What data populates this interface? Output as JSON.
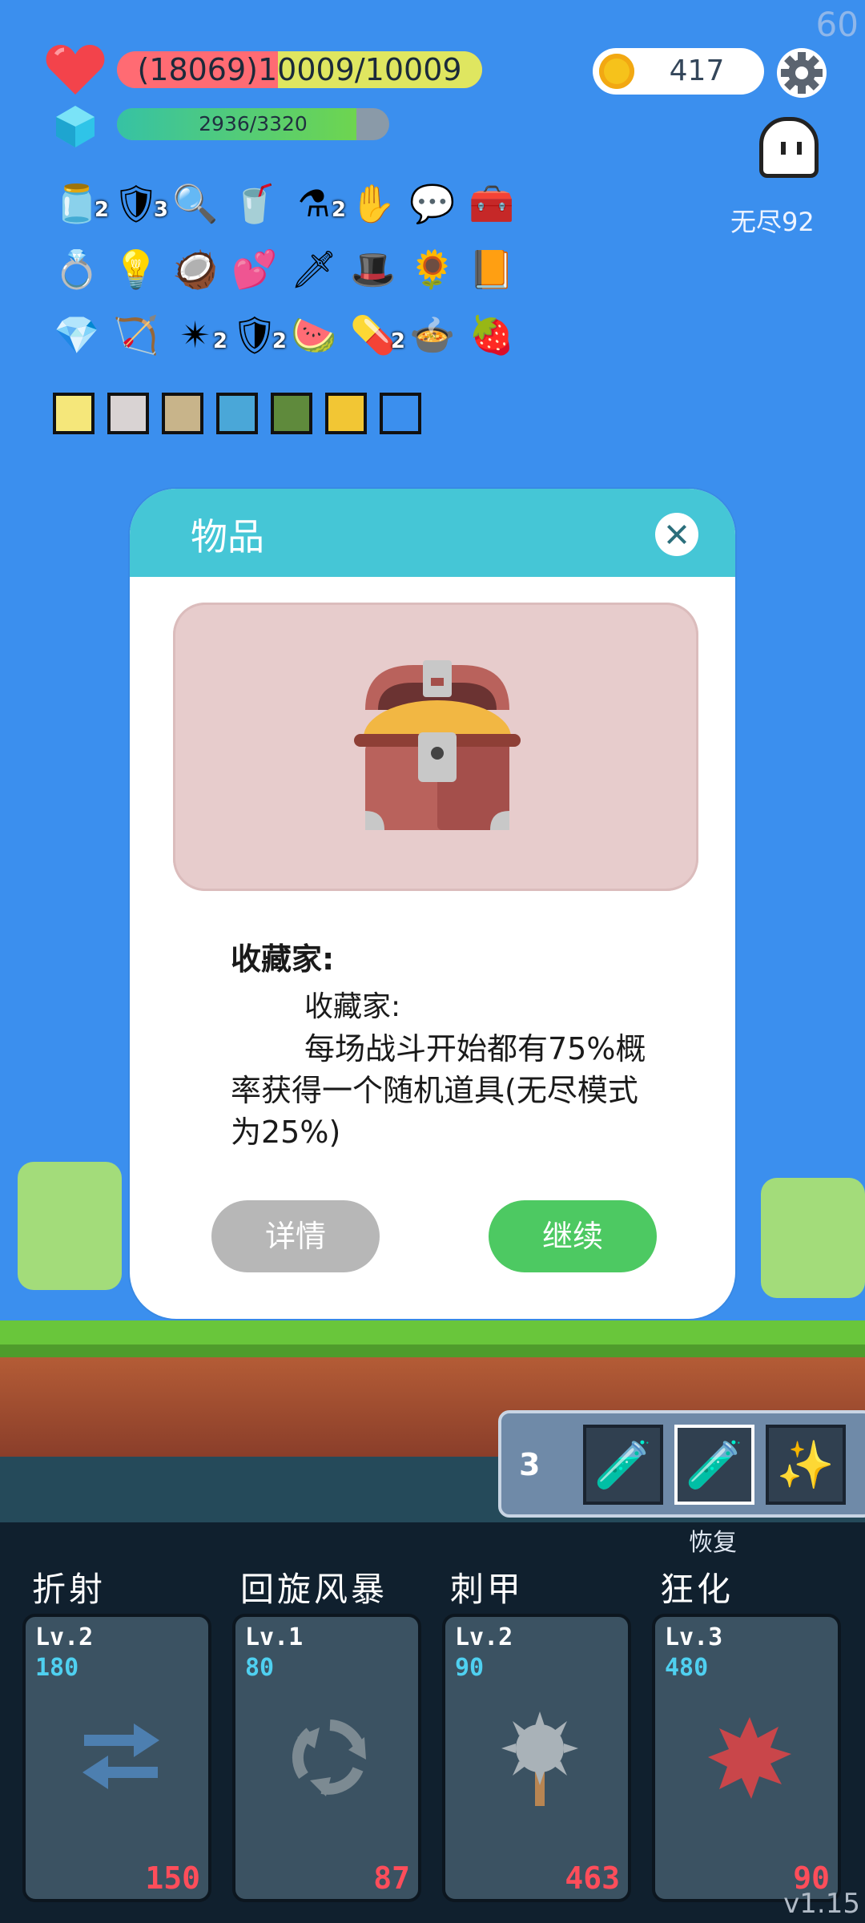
{
  "fps": "60",
  "hud": {
    "hp_text": "(18069)10009/10009",
    "mp_text": "2936/3320",
    "gold": "417",
    "mode_label": "无尽92"
  },
  "items": [
    {
      "icon": "jam-jar",
      "glyph": "🫙",
      "count": "2"
    },
    {
      "icon": "shield-round",
      "glyph": "🛡",
      "count": "3"
    },
    {
      "icon": "magnifier",
      "glyph": "🔍",
      "count": ""
    },
    {
      "icon": "coconut-drink",
      "glyph": "🥤",
      "count": ""
    },
    {
      "icon": "potion-flask",
      "glyph": "⚗",
      "count": "2"
    },
    {
      "icon": "white-glove",
      "glyph": "✋",
      "count": ""
    },
    {
      "icon": "speech-bubble",
      "glyph": "💬",
      "count": ""
    },
    {
      "icon": "treasure-chest",
      "glyph": "🧰",
      "count": ""
    },
    {
      "icon": "ring",
      "glyph": "💍",
      "count": ""
    },
    {
      "icon": "lightbulb",
      "glyph": "💡",
      "count": ""
    },
    {
      "icon": "coconut",
      "glyph": "🥥",
      "count": ""
    },
    {
      "icon": "hearts",
      "glyph": "💕",
      "count": ""
    },
    {
      "icon": "sword",
      "glyph": "🗡",
      "count": ""
    },
    {
      "icon": "purple-hat",
      "glyph": "🎩",
      "count": ""
    },
    {
      "icon": "sunflower",
      "glyph": "🌻",
      "count": ""
    },
    {
      "icon": "book",
      "glyph": "📙",
      "count": ""
    },
    {
      "icon": "blue-gem",
      "glyph": "💎",
      "count": ""
    },
    {
      "icon": "bow",
      "glyph": "🏹",
      "count": ""
    },
    {
      "icon": "spiked-mace",
      "glyph": "✴",
      "count": "2"
    },
    {
      "icon": "red-shield",
      "glyph": "🛡",
      "count": "2"
    },
    {
      "icon": "watermelon",
      "glyph": "🍉",
      "count": ""
    },
    {
      "icon": "pill",
      "glyph": "💊",
      "count": "2"
    },
    {
      "icon": "pot",
      "glyph": "🍲",
      "count": ""
    },
    {
      "icon": "strawberry",
      "glyph": "🍓",
      "count": ""
    }
  ],
  "buffs": [
    {
      "icon": "light-buff",
      "color": "#f5e77a"
    },
    {
      "icon": "blade-buff",
      "color": "#d9d3d3"
    },
    {
      "icon": "armor-buff",
      "color": "#c8b48a"
    },
    {
      "icon": "water-buff",
      "color": "#4aa7d8"
    },
    {
      "icon": "nature-buff",
      "color": "#5f8a3c"
    },
    {
      "icon": "shadow-buff",
      "color": "#f2c634"
    },
    {
      "icon": "vortex-buff",
      "color": "#3b8fee"
    }
  ],
  "modal": {
    "title": "物品",
    "item_name": "收藏家:",
    "item_sub": "收藏家:",
    "item_desc": "每场战斗开始都有75%概率获得一个随机道具(无尽模式为25%)",
    "detail_button": "详情",
    "continue_button": "继续"
  },
  "potions": {
    "count": "3",
    "label": "恢复",
    "slots": [
      {
        "icon": "pink-potion",
        "glyph": "🧪"
      },
      {
        "icon": "pink-potion-selected",
        "glyph": "🧪"
      },
      {
        "icon": "spark-potion",
        "glyph": "✨"
      }
    ]
  },
  "skills": [
    {
      "name": "折射",
      "level": "Lv.2",
      "cost": "180",
      "value": "150",
      "icon": "refract-arrows-icon"
    },
    {
      "name": "回旋风暴",
      "level": "Lv.1",
      "cost": "80",
      "value": "87",
      "icon": "whirlwind-icon"
    },
    {
      "name": "刺甲",
      "level": "Lv.2",
      "cost": "90",
      "value": "463",
      "icon": "spiked-armor-icon"
    },
    {
      "name": "狂化",
      "level": "Lv.3",
      "cost": "480",
      "value": "90",
      "icon": "berserk-splash-icon"
    }
  ],
  "version": "v1.15"
}
